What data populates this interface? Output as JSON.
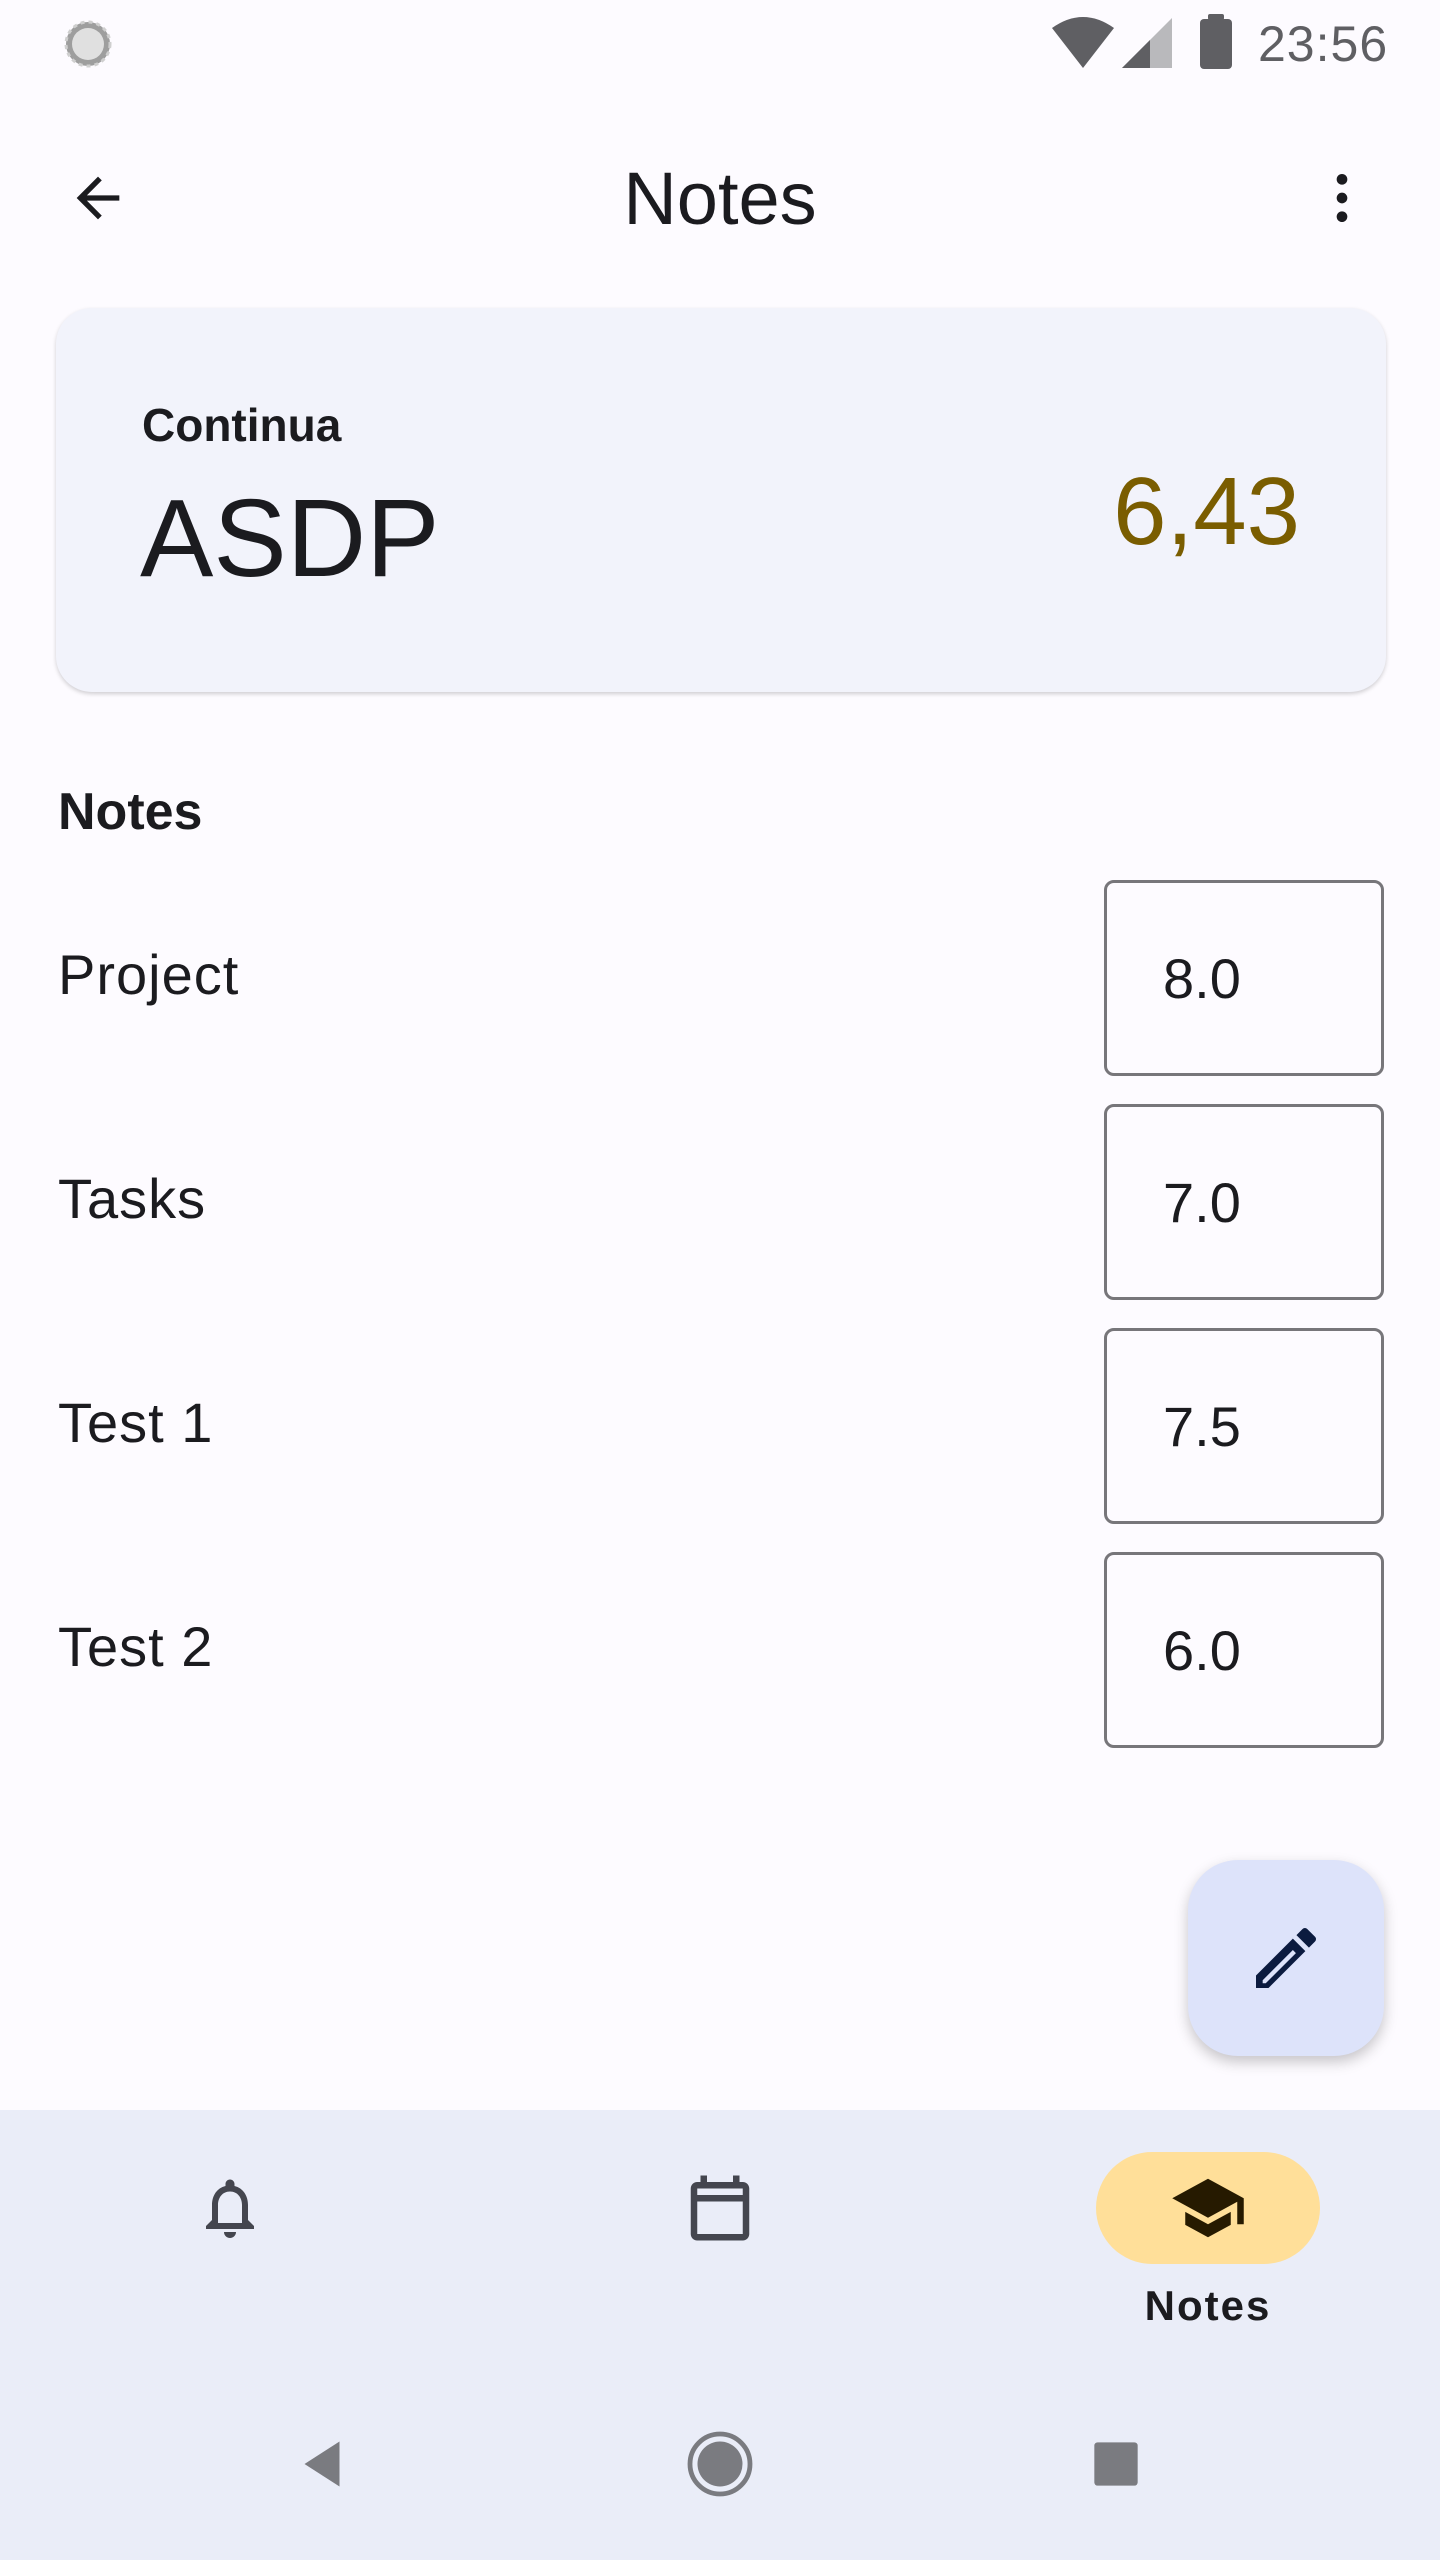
{
  "status_bar": {
    "time": "23:56",
    "icons": [
      "sync-icon",
      "wifi-icon",
      "signal-icon",
      "battery-icon"
    ]
  },
  "app_bar": {
    "title": "Notes",
    "back_icon": "arrow-left-icon",
    "menu_icon": "more-vertical-icon"
  },
  "summary": {
    "subject_type": "Continua",
    "subject_name": "ASDP",
    "average": "6,43",
    "average_color": "#7a5d00"
  },
  "notes_section": {
    "heading": "Notes",
    "rows": [
      {
        "label": "Project",
        "value": "8.0"
      },
      {
        "label": "Tasks",
        "value": "7.0"
      },
      {
        "label": "Test 1",
        "value": "7.5"
      },
      {
        "label": "Test 2",
        "value": "6.0"
      }
    ]
  },
  "fab": {
    "icon": "pencil-icon",
    "background": "#dde3fa"
  },
  "bottom_nav": {
    "items": [
      {
        "icon": "bell-icon",
        "label": "",
        "active": false
      },
      {
        "icon": "calendar-icon",
        "label": "",
        "active": false
      },
      {
        "icon": "graduation-cap-icon",
        "label": "Notes",
        "active": true
      }
    ],
    "active_indicator_color": "#ffdf99"
  },
  "system_nav": {
    "icons": [
      "back-triangle-icon",
      "home-circle-icon",
      "recents-square-icon"
    ]
  }
}
